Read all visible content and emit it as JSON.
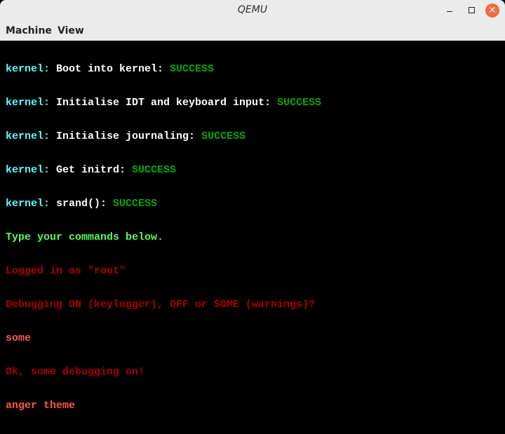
{
  "window": {
    "title": "QEMU",
    "close_icon": "×"
  },
  "menu": [
    "Machine",
    "View"
  ],
  "colors": {
    "cyan": "#55ffff",
    "white": "#ffffff",
    "green": "#00aa00",
    "light_green": "#55ff55",
    "red": "#aa0000",
    "light_red": "#ff5555"
  },
  "terminal": {
    "kernel_lines": [
      {
        "prefix": "kernel: ",
        "msg": "Boot into kernel: ",
        "status": "SUCCESS"
      },
      {
        "prefix": "kernel: ",
        "msg": "Initialise IDT and keyboard input: ",
        "status": "SUCCESS"
      },
      {
        "prefix": "kernel: ",
        "msg": "Initialise journaling: ",
        "status": "SUCCESS"
      },
      {
        "prefix": "kernel: ",
        "msg": "Get initrd: ",
        "status": "SUCCESS"
      },
      {
        "prefix": "kernel: ",
        "msg": "srand(): ",
        "status": "SUCCESS"
      }
    ],
    "prompt": "Type your commands below.",
    "logged_in": "Logged in as \"root\"",
    "debug_question": "Debugging ON (keylogger), OFF or SOME (warnings)?",
    "input1": "some",
    "debug_reply": "Ok, some debugging on!",
    "input2": "anger theme"
  }
}
